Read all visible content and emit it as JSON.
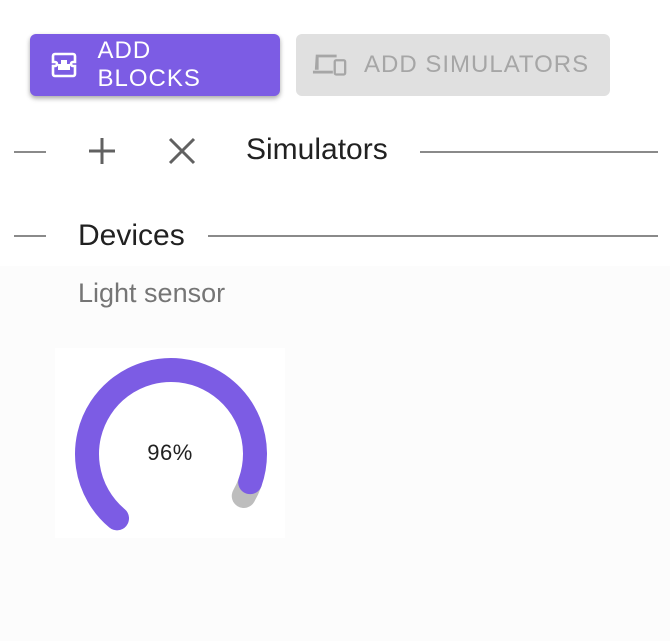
{
  "toolbar": {
    "add_blocks_label": "ADD BLOCKS",
    "add_simulators_label": "ADD SIMULATORS",
    "add_blocks_icon": "blocks-icon",
    "add_simulators_icon": "devices-icon"
  },
  "simulators_section": {
    "title": "Simulators",
    "add_icon": "plus-icon",
    "close_icon": "close-icon"
  },
  "devices_section": {
    "title": "Devices",
    "device": {
      "name": "Light sensor",
      "value_label": "96%",
      "value_fraction": 0.96
    }
  },
  "colors": {
    "accent": "#7c5ce4",
    "disabled_bg": "#e0e0e0",
    "disabled_text": "#a6a6a6",
    "gauge_track": "#bdbdbd"
  }
}
